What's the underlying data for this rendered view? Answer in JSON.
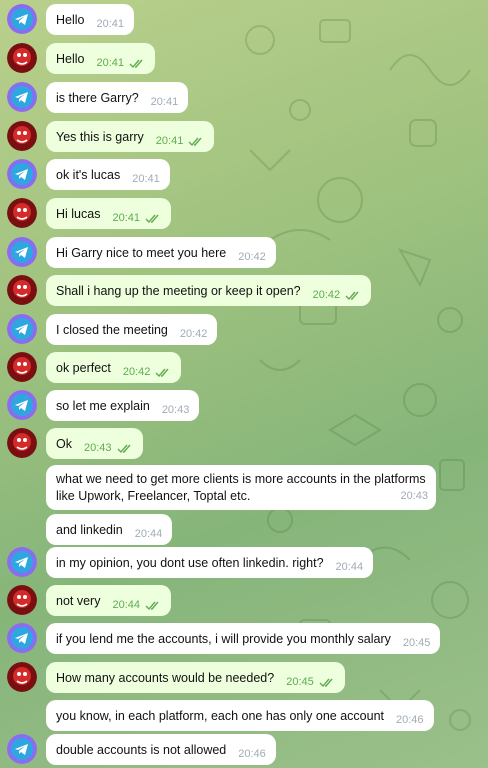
{
  "messages": [
    {
      "sender": "telegram",
      "text": "Hello",
      "time": "20:41"
    },
    {
      "sender": "garry",
      "text": "Hello",
      "time": "20:41",
      "read": true
    },
    {
      "sender": "telegram",
      "text": "is there Garry?",
      "time": "20:41"
    },
    {
      "sender": "garry",
      "text": "Yes this is garry",
      "time": "20:41",
      "read": true
    },
    {
      "sender": "telegram",
      "text": "ok it's lucas",
      "time": "20:41"
    },
    {
      "sender": "garry",
      "text": "Hi lucas",
      "time": "20:41",
      "read": true
    },
    {
      "sender": "telegram",
      "text": "Hi Garry nice to meet you here",
      "time": "20:42"
    },
    {
      "sender": "garry",
      "text": "Shall i hang up the meeting or keep it open?",
      "time": "20:42",
      "read": true
    },
    {
      "sender": "telegram",
      "text": "I closed the meeting",
      "time": "20:42"
    },
    {
      "sender": "garry",
      "text": "ok perfect",
      "time": "20:42",
      "read": true
    },
    {
      "sender": "telegram",
      "text": "so let me explain",
      "time": "20:43"
    },
    {
      "sender": "garry",
      "text": "Ok",
      "time": "20:43",
      "read": true
    },
    {
      "sender": "telegram",
      "text_line1": "what we need to get more clients is more accounts in the platforms",
      "text_line2": "like Upwork, Freelancer, Toptal etc.",
      "time": "20:43"
    },
    {
      "sender": "telegram",
      "text": "and linkedin",
      "time": "20:44"
    },
    {
      "sender": "telegram",
      "text": "in my opinion, you dont use often linkedin. right?",
      "time": "20:44"
    },
    {
      "sender": "garry",
      "text": "not very",
      "time": "20:44",
      "read": true
    },
    {
      "sender": "telegram",
      "text": "if you lend me the accounts, i will provide you monthly salary",
      "time": "20:45"
    },
    {
      "sender": "garry",
      "text": "How many accounts would be needed?",
      "time": "20:45",
      "read": true
    },
    {
      "sender": "telegram",
      "text": "you know, in each platform, each one has only one account",
      "time": "20:46"
    },
    {
      "sender": "telegram",
      "text": "double accounts is not allowed",
      "time": "20:46"
    }
  ],
  "colors": {
    "incoming_bubble": "#ffffff",
    "outgoing_bubble": "#eeffde",
    "read_tick": "#5fab4f",
    "telegram_avatar": "#8a6cf0"
  },
  "icons": {
    "telegram_avatar": "telegram-logo-icon",
    "garry_avatar": "red-character-avatar",
    "read_receipt": "double-check-icon"
  }
}
